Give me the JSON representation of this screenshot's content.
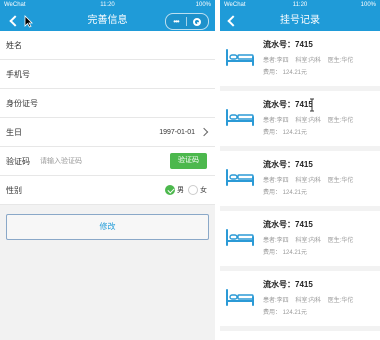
{
  "status": {
    "carrier": "WeChat",
    "time": "11:20",
    "battery": "100%"
  },
  "left": {
    "title": "完善信息",
    "fields": {
      "name": {
        "label": "姓名"
      },
      "phone": {
        "label": "手机号"
      },
      "idcard": {
        "label": "身份证号"
      },
      "birthday": {
        "label": "生日",
        "value": "1997-01-01"
      },
      "code": {
        "label": "验证码",
        "placeholder": "请输入验证码",
        "button": "验证码"
      },
      "gender": {
        "label": "性别",
        "options": [
          {
            "label": "男",
            "checked": true
          },
          {
            "label": "女",
            "checked": false
          }
        ]
      }
    },
    "submit": "修改"
  },
  "right": {
    "title": "挂号记录",
    "records": [
      {
        "serial": "流水号：7415",
        "patient": "患者:李四",
        "dept": "科室:内科",
        "doctor": "医生:华佗",
        "fee": "费用： 124.21元"
      },
      {
        "serial": "流水号：7415",
        "patient": "患者:李四",
        "dept": "科室:内科",
        "doctor": "医生:华佗",
        "fee": "费用： 124.21元"
      },
      {
        "serial": "流水号：7415",
        "patient": "患者:李四",
        "dept": "科室:内科",
        "doctor": "医生:华佗",
        "fee": "费用： 124.21元"
      },
      {
        "serial": "流水号：7415",
        "patient": "患者:李四",
        "dept": "科室:内科",
        "doctor": "医生:华佗",
        "fee": "费用： 124.21元"
      },
      {
        "serial": "流水号：7415",
        "patient": "患者:李四",
        "dept": "科室:内科",
        "doctor": "医生:华佗",
        "fee": "费用： 124.21元"
      }
    ]
  },
  "colors": {
    "navbar": "#1f9bd8",
    "green": "#4cb84d",
    "icon": "#2b9ad6"
  }
}
